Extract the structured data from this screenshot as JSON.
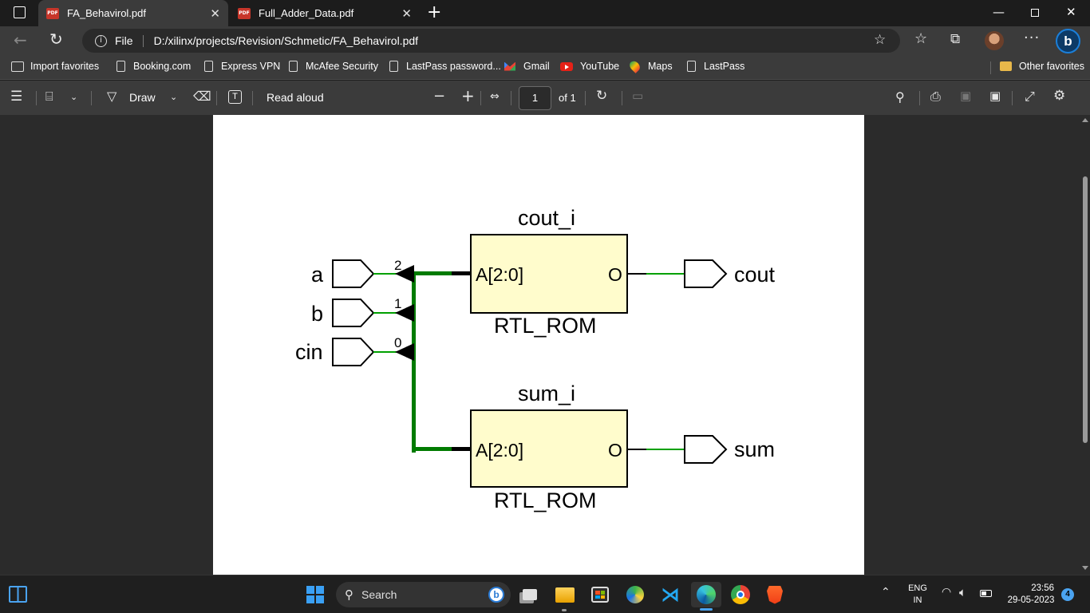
{
  "tabs": [
    {
      "label": "FA_Behavirol.pdf",
      "active": true,
      "icon_text": "PDF"
    },
    {
      "label": "Full_Adder_Data.pdf",
      "active": false,
      "icon_text": "PDF"
    }
  ],
  "address": {
    "scheme_label": "File",
    "url": "D:/xilinx/projects/Revision/Schmetic/FA_Behavirol.pdf"
  },
  "favorites": [
    {
      "label": "Import favorites",
      "icon": "import-icon"
    },
    {
      "label": "Booking.com",
      "icon": "page-icon"
    },
    {
      "label": "Express VPN",
      "icon": "page-icon"
    },
    {
      "label": "McAfee Security",
      "icon": "page-icon"
    },
    {
      "label": "LastPass password...",
      "icon": "page-icon"
    },
    {
      "label": "Gmail",
      "icon": "gmail-icon"
    },
    {
      "label": "YouTube",
      "icon": "youtube-icon"
    },
    {
      "label": "Maps",
      "icon": "maps-icon"
    },
    {
      "label": "LastPass",
      "icon": "page-icon"
    }
  ],
  "other_favorites": "Other favorites",
  "pdf_toolbar": {
    "draw_label": "Draw",
    "read_aloud_label": "Read aloud",
    "page_number": "1",
    "page_total": "of 1"
  },
  "schematic": {
    "inputs": [
      {
        "name": "a",
        "bit": "2"
      },
      {
        "name": "b",
        "bit": "1"
      },
      {
        "name": "cin",
        "bit": "0"
      }
    ],
    "blocks": [
      {
        "instance": "cout_i",
        "type": "RTL_ROM",
        "in_pin": "A[2:0]",
        "out_pin": "O",
        "output": "cout"
      },
      {
        "instance": "sum_i",
        "type": "RTL_ROM",
        "in_pin": "A[2:0]",
        "out_pin": "O",
        "output": "sum"
      }
    ],
    "colors": {
      "block_fill": "#fffccc",
      "wire": "#00a000",
      "bus": "#007b00"
    }
  },
  "taskbar": {
    "search_label": "Search",
    "lang_top": "ENG",
    "lang_bottom": "IN",
    "time": "23:56",
    "date": "29-05-2023",
    "notification_count": "4"
  }
}
